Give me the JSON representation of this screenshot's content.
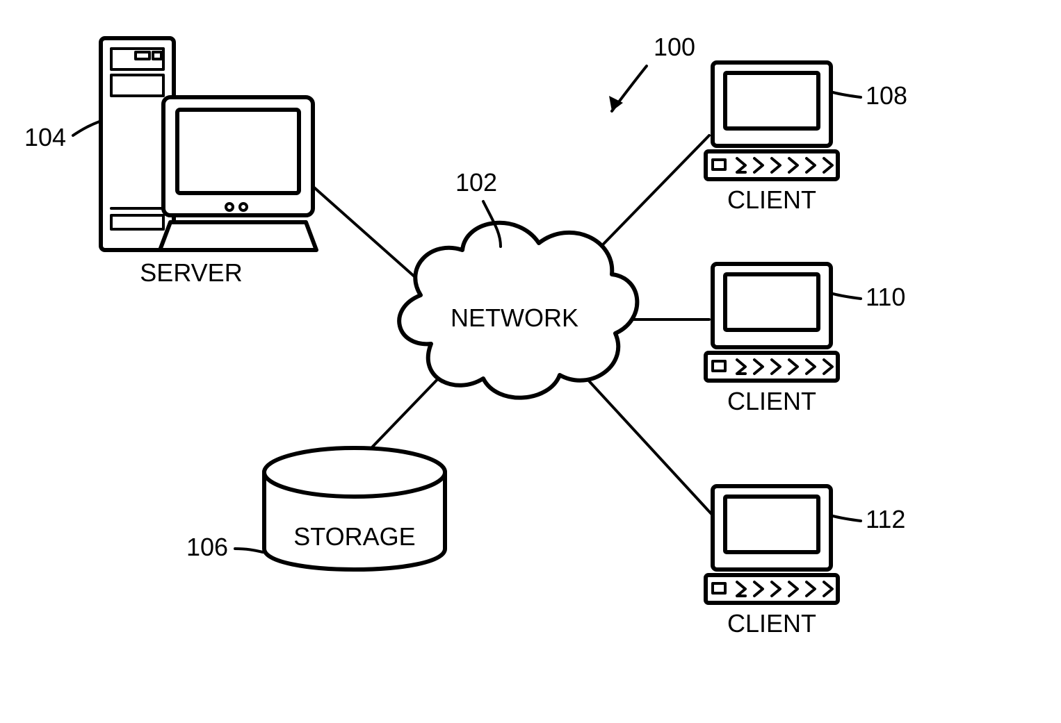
{
  "diagram": {
    "ref_system": "100",
    "network": {
      "label": "NETWORK",
      "ref": "102"
    },
    "server": {
      "label": "SERVER",
      "ref": "104"
    },
    "storage": {
      "label": "STORAGE",
      "ref": "106"
    },
    "client1": {
      "label": "CLIENT",
      "ref": "108"
    },
    "client2": {
      "label": "CLIENT",
      "ref": "110"
    },
    "client3": {
      "label": "CLIENT",
      "ref": "112"
    }
  }
}
